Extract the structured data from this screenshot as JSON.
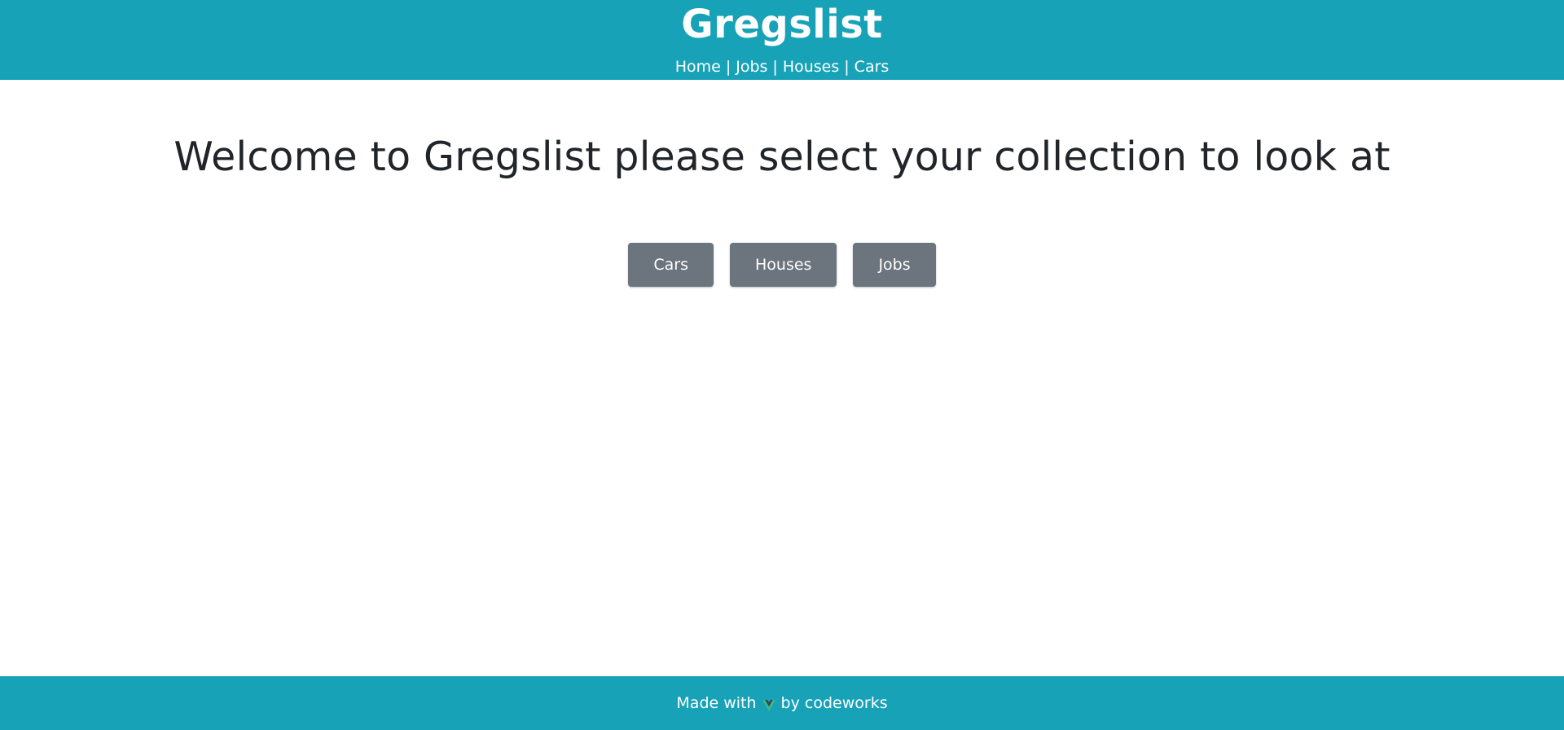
{
  "header": {
    "brand": "Gregslist",
    "nav": {
      "home": "Home",
      "jobs": "Jobs",
      "houses": "Houses",
      "cars": "Cars",
      "separator": "|"
    }
  },
  "main": {
    "welcome": "Welcome to Gregslist please select your collection to look at",
    "buttons": {
      "cars": "Cars",
      "houses": "Houses",
      "jobs": "Jobs"
    }
  },
  "footer": {
    "made_with": "Made with",
    "icon": "vue-logo-icon",
    "by": "by codeworks"
  },
  "colors": {
    "header_bg": "#17a2b8",
    "button_bg": "#6c757d",
    "vue_green": "#41b883",
    "vue_dark": "#35495e"
  }
}
